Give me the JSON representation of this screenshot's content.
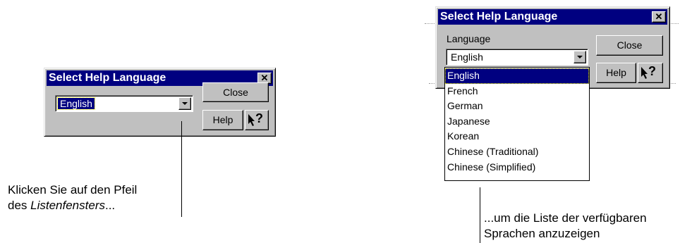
{
  "dialog": {
    "title": "Select Help Language",
    "close_glyph": "✕",
    "language_label": "Language",
    "selected_language": "English",
    "close_button": "Close",
    "help_button": "Help",
    "whats_this_button": "?"
  },
  "dropdown": {
    "options": [
      "English",
      "French",
      "German",
      "Japanese",
      "Korean",
      "Chinese (Traditional)",
      "Chinese (Simplified)"
    ],
    "selected_index": 0
  },
  "captions": {
    "left_line1": "Klicken Sie auf den Pfeil",
    "left_line2_prefix": "des ",
    "left_line2_em": "Listenfensters",
    "left_line2_suffix": "...",
    "right_line1": "...um die Liste der verfügbaren",
    "right_line2": "Sprachen anzuzeigen"
  },
  "icons": {
    "close": "close-icon",
    "dropdown_arrow": "chevron-down-icon",
    "whats_this": "arrow-question-icon"
  },
  "colors": {
    "titlebar": "#000080",
    "dialog_face": "#c0c0c0",
    "selection": "#000080"
  }
}
